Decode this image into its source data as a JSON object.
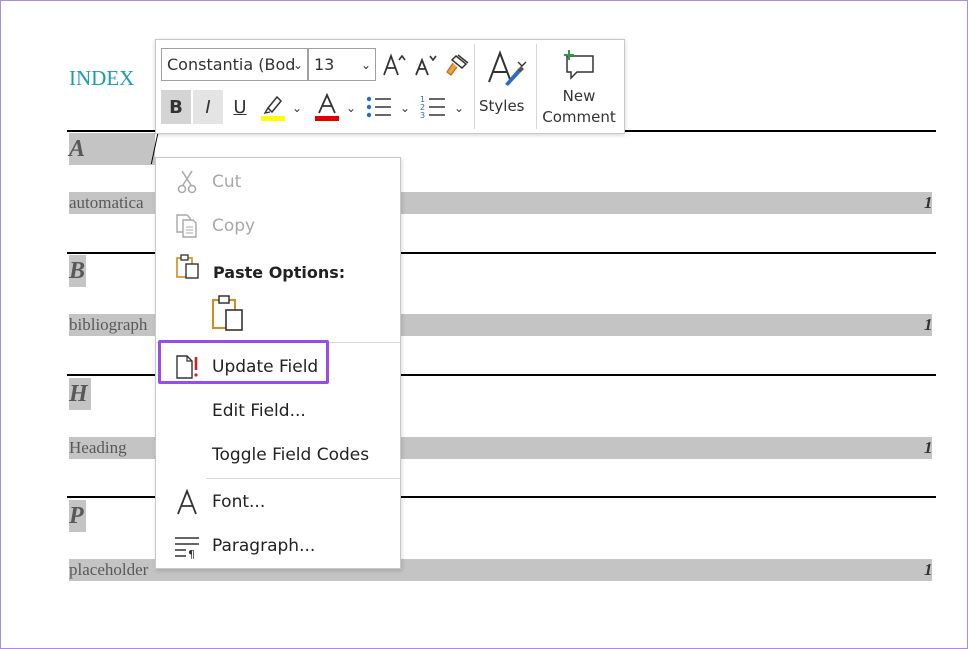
{
  "document": {
    "index_title": "INDEX",
    "sections": [
      {
        "letter": "A",
        "entry": "automatica",
        "page": "1"
      },
      {
        "letter": "B",
        "entry": "bibliograph",
        "page": "1"
      },
      {
        "letter": "H",
        "entry": "Heading",
        "page": "1"
      },
      {
        "letter": "P",
        "entry": "placeholder",
        "page": "1"
      }
    ]
  },
  "toolbar": {
    "font_name": "Constantia (Bod",
    "font_size": "13",
    "bold_label": "B",
    "italic_label": "I",
    "underline_label": "U",
    "styles_label": "Styles",
    "new_comment_line1": "New",
    "new_comment_line2": "Comment",
    "highlight_color": "#ffff00",
    "font_color": "#e00000"
  },
  "context_menu": {
    "cut": "Cut",
    "copy": "Copy",
    "paste_options": "Paste Options:",
    "update_field": "Update Field",
    "edit_field": "Edit Field...",
    "toggle_field_codes": "Toggle Field Codes",
    "font": "Font...",
    "paragraph": "Paragraph...",
    "highlight_color": "#9a4ce6"
  }
}
